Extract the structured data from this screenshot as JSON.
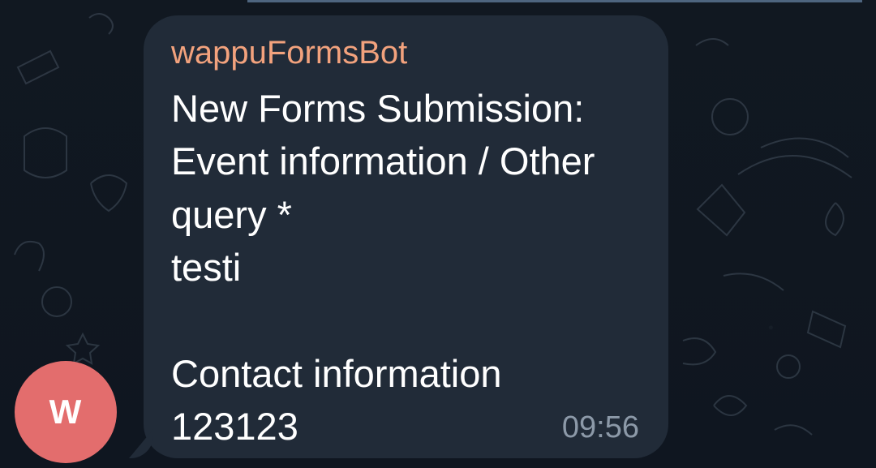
{
  "chat": {
    "avatar": {
      "initial": "W",
      "color": "#e36d6d"
    },
    "message": {
      "sender": "wappuFormsBot",
      "body": "New Forms Submission:\nEvent information / Other\nquery *\ntesti\n\nContact information\n123123",
      "time": "09:56"
    },
    "colors": {
      "background": "#0f1720",
      "bubble": "#212b38",
      "sender": "#f2a27d",
      "text": "#ffffff",
      "timestamp": "#8c99a8",
      "accent_strip": "#59738f"
    }
  }
}
